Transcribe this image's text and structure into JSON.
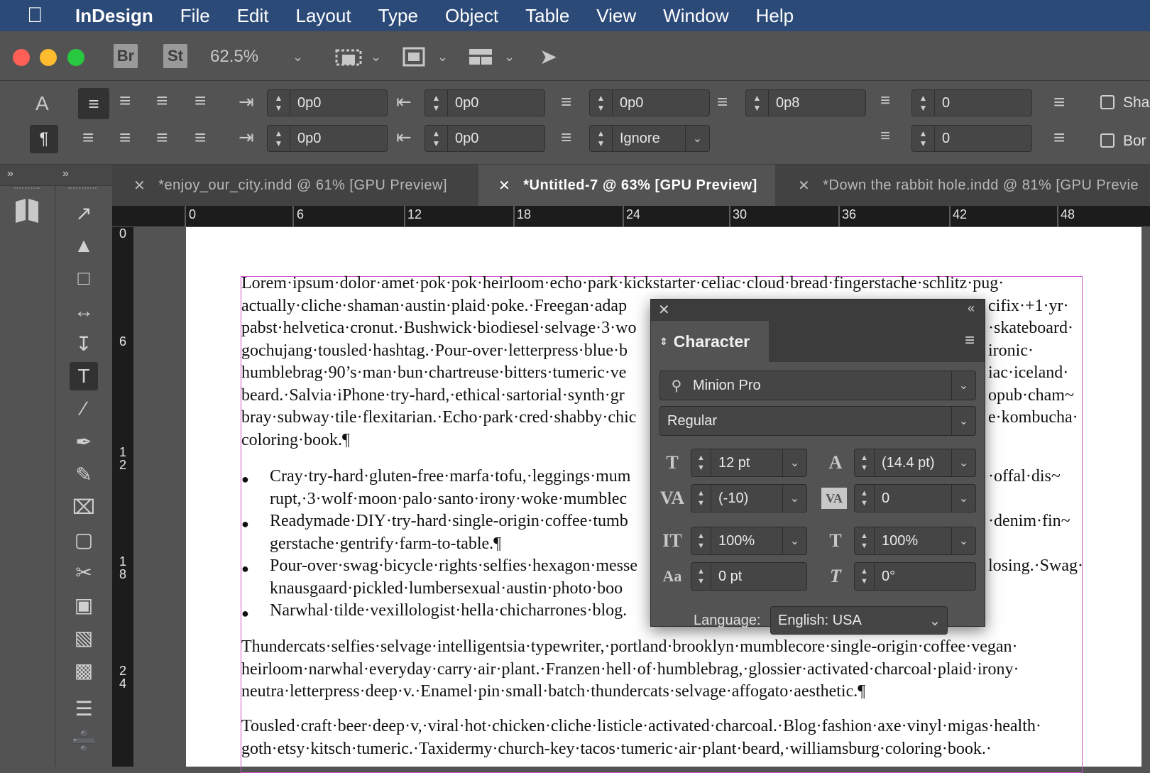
{
  "menubar": {
    "app": "InDesign",
    "items": [
      "File",
      "Edit",
      "Layout",
      "Type",
      "Object",
      "Table",
      "View",
      "Window",
      "Help"
    ]
  },
  "appbar": {
    "bridge": "Br",
    "stock": "St",
    "zoom": "62.5%"
  },
  "control": {
    "left_indent": "0p0",
    "right_indent": "0p0",
    "first_line_indent": "0p0",
    "last_line_indent": "0p0",
    "space_before": "0p0",
    "space_after": "0p8",
    "align_to_grid": "Ignore",
    "drop_cap_lines": "0",
    "drop_cap_chars": "0",
    "shading_label": "Sha",
    "border_label": "Bor"
  },
  "tabs": [
    "*enjoy_our_city.indd @ 61% [GPU Preview]",
    "*Untitled-7 @ 63% [GPU Preview]",
    "*Down the rabbit hole.indd @ 81% [GPU Previe"
  ],
  "ruler": {
    "h": [
      "0",
      "6",
      "12",
      "18",
      "24",
      "30",
      "36",
      "42",
      "48"
    ],
    "v": [
      "0",
      "6",
      "1\n2",
      "1\n8",
      "2\n4"
    ]
  },
  "document": {
    "lines": [
      "Lorem·ipsum·dolor·amet·pok·pok·heirloom·echo·park·kickstarter·celiac·cloud·bread·fingerstache·schlitz·pug·",
      "actually·cliche·shaman·austin·plaid·poke.·Freegan·adap",
      "pabst·helvetica·cronut.·Bushwick·biodiesel·selvage·3·wo",
      "gochujang·tousled·hashtag.·Pour-over·letterpress·blue·b",
      "humblebrag·90’s·man·bun·chartreuse·bitters·tumeric·ve",
      "beard.·Salvia·iPhone·try-hard,·ethical·sartorial·synth·gr",
      "bray·subway·tile·flexitarian.·Echo·park·cred·shabby·chic",
      "coloring·book.¶"
    ],
    "lines_right": [
      "cifix·+1·yr·",
      "·skateboard·",
      "ironic·",
      "iac·iceland·",
      "opub·cham~",
      "e·kombucha·"
    ],
    "bullets": [
      "Cray·try-hard·gluten-free·marfa·tofu,·leggings·mum",
      "rupt,·3·wolf·moon·palo·santo·irony·woke·mumblec",
      "Readymade·DIY·try-hard·single-origin·coffee·tumb",
      "gerstache·gentrify·farm-to-table.¶",
      "Pour-over·swag·bicycle·rights·selfies·hexagon·messe",
      "knausgaard·pickled·lumbersexual·austin·photo·boo",
      "Narwhal·tilde·vexillologist·hella·chicharrones·blog."
    ],
    "bullets_right": [
      "·offal·dis~",
      "·denim·fin~",
      "losing.·Swag·"
    ],
    "para2": [
      "Thundercats·selfies·selvage·intelligentsia·typewriter,·portland·brooklyn·mumblecore·single-origin·coffee·vegan·",
      "heirloom·narwhal·everyday·carry·air·plant.·Franzen·hell·of·humblebrag,·glossier·activated·charcoal·plaid·irony·",
      "neutra·letterpress·deep·v.·Enamel·pin·small·batch·thundercats·selvage·affogato·aesthetic.¶"
    ],
    "para3": [
      "Tousled·craft·beer·deep·v,·viral·hot·chicken·cliche·listicle·activated·charcoal.·Blog·fashion·axe·vinyl·migas·health·",
      "goth·etsy·kitsch·tumeric.·Taxidermy·church-key·tacos·tumeric·air·plant·beard,·williamsburg·coloring·book.·"
    ]
  },
  "character_panel": {
    "title": "Character",
    "font_family": "Minion Pro",
    "font_style": "Regular",
    "size": "12 pt",
    "leading": "(14.4 pt)",
    "kerning": "(-10)",
    "tracking": "0",
    "vertical_scale": "100%",
    "horizontal_scale": "100%",
    "baseline_shift": "0 pt",
    "skew": "0°",
    "language_label": "Language:",
    "language": "English: USA"
  },
  "colors": {
    "menubar": "#2c4a78",
    "ui": "#535353",
    "frame": "#cc55cc"
  }
}
